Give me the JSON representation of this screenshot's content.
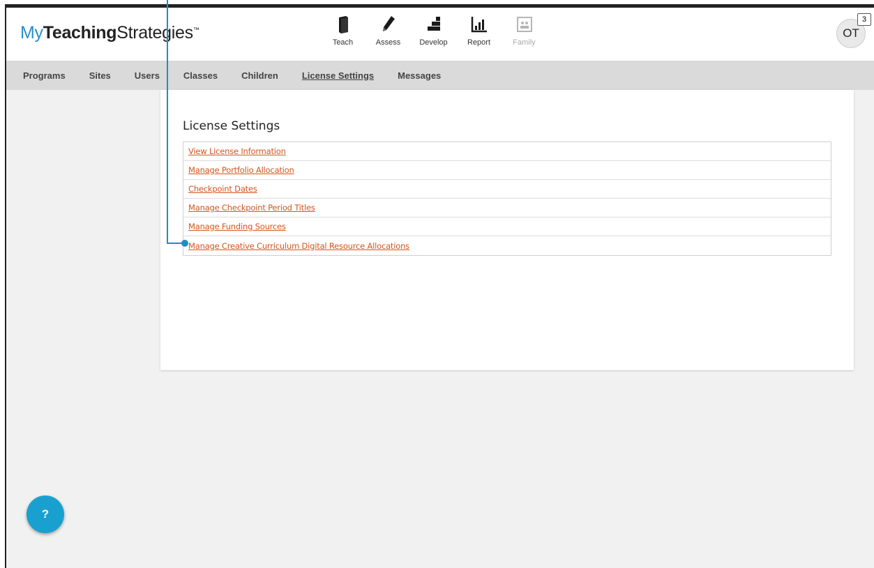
{
  "logo": {
    "my": "My",
    "teaching": "Teaching",
    "strategies": "Strategies",
    "tm": "™"
  },
  "topnav": [
    {
      "label": "Teach",
      "icon": "book-icon"
    },
    {
      "label": "Assess",
      "icon": "pencil-icon"
    },
    {
      "label": "Develop",
      "icon": "blocks-icon"
    },
    {
      "label": "Report",
      "icon": "bar-chart-icon"
    },
    {
      "label": "Family",
      "icon": "family-photo-icon",
      "disabled": true
    }
  ],
  "user": {
    "initials": "OT",
    "notification_count": "3"
  },
  "subnav": {
    "items": [
      "Programs",
      "Sites",
      "Users",
      "Classes",
      "Children",
      "License Settings",
      "Messages"
    ],
    "active": "License Settings"
  },
  "license_settings": {
    "title": "License Settings",
    "links": [
      "View License Information",
      "Manage Portfolio Allocation",
      "Checkpoint Dates",
      "Manage Checkpoint Period Titles",
      "Manage Funding Sources",
      "Manage Creative Curriculum Digital Resource Allocations"
    ]
  },
  "help": {
    "label": "?"
  },
  "colors": {
    "link": "#d6541c",
    "brand_blue": "#2a8fc9",
    "help_button": "#1aa0cf",
    "annotation": "#1d8fc0"
  }
}
